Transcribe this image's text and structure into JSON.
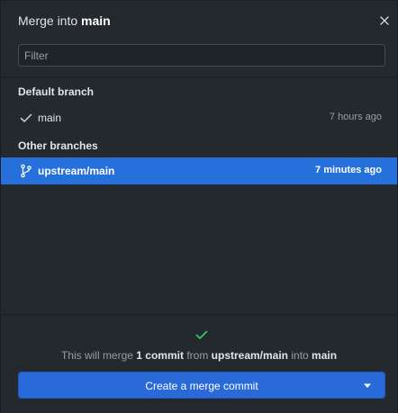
{
  "dialog": {
    "title_prefix": "Merge into ",
    "title_branch": "main",
    "close_icon": "close-icon"
  },
  "filter": {
    "placeholder": "Filter",
    "value": ""
  },
  "groups": {
    "default": {
      "header": "Default branch",
      "items": [
        {
          "name": "main",
          "time": "7 hours ago",
          "icon": "check-icon",
          "selected": false
        }
      ]
    },
    "other": {
      "header": "Other branches",
      "items": [
        {
          "name": "upstream/main",
          "time": "7 minutes ago",
          "icon": "git-branch-icon",
          "selected": true
        }
      ]
    }
  },
  "footer": {
    "status_icon": "check-icon",
    "summary": {
      "prefix": "This will merge ",
      "count": "1 commit",
      "from_word": " from ",
      "source": "upstream/main",
      "into_word": " into ",
      "target": "main"
    },
    "button_label": "Create a merge commit",
    "dropdown_icon": "caret-down-icon"
  },
  "colors": {
    "background": "#24292e",
    "selected_row": "#2670db",
    "button": "#2a6ad8",
    "success_check": "#34d058"
  }
}
